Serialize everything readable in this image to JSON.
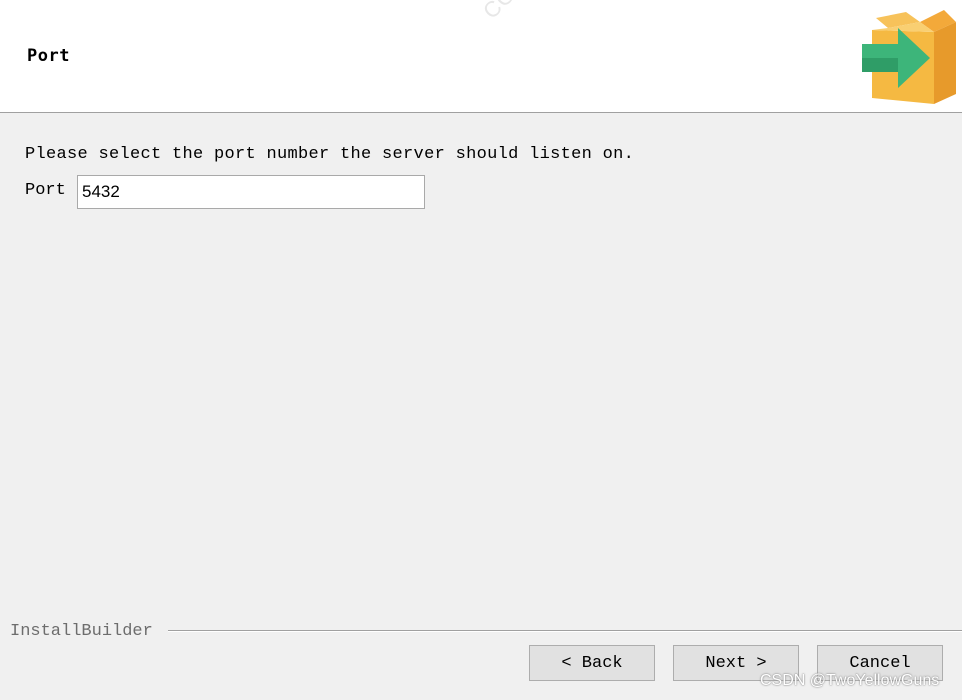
{
  "header": {
    "title": "Port",
    "logo_icon": "installer-box-arrow-icon",
    "watermark": "COCA"
  },
  "main": {
    "instruction": "Please select the port number the server should listen on.",
    "port_label": "Port",
    "port_value": "5432"
  },
  "footer": {
    "brand": "InstallBuilder",
    "back_label": "< Back",
    "next_label": "Next >",
    "cancel_label": "Cancel",
    "watermark": "CSDN @TwoYellowGuns"
  },
  "colors": {
    "background": "#f0f0f0",
    "header_background": "#ffffff",
    "button_face": "#e1e1e1",
    "box_orange": "#f5b942",
    "arrow_green": "#3db57a"
  }
}
